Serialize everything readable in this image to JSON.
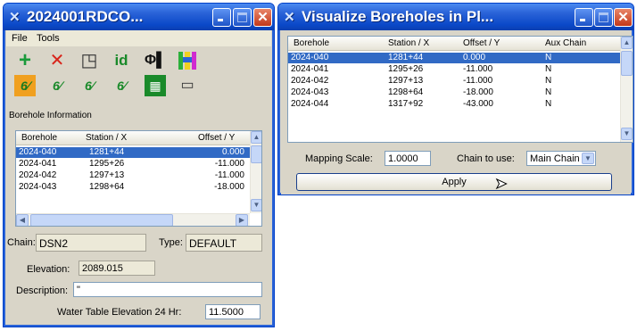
{
  "win1": {
    "title": "2024001RDCO...",
    "menu": [
      "File",
      "Tools"
    ],
    "tools_row1": [
      {
        "icon": "add-point-icon",
        "glyph": "+"
      },
      {
        "icon": "delete-icon",
        "glyph": "✕"
      },
      {
        "icon": "window-icon",
        "glyph": "◳"
      },
      {
        "icon": "id-icon",
        "glyph": "id"
      },
      {
        "icon": "diameter-icon",
        "glyph": "Φ▌"
      },
      {
        "icon": "color-bars-icon",
        "glyph": "▐▌"
      }
    ],
    "tools_row2": [
      {
        "icon": "borehole-symbol-icon",
        "glyph": "6∕"
      },
      {
        "icon": "borehole-tool-icon",
        "glyph": "6∕"
      },
      {
        "icon": "borehole-edit-icon",
        "glyph": "6∕"
      },
      {
        "icon": "borehole-elevation-icon",
        "glyph": "6∕"
      },
      {
        "icon": "import-csv-icon",
        "glyph": "▦"
      },
      {
        "icon": "text-note-icon",
        "glyph": "▭"
      }
    ],
    "section_label": "Borehole Information",
    "columns": [
      "Borehole",
      "Station / X",
      "Offset / Y"
    ],
    "rows": [
      {
        "borehole": "2024-040",
        "station": "1281+44",
        "offset": "0.000",
        "selected": true
      },
      {
        "borehole": "2024-041",
        "station": "1295+26",
        "offset": "-11.000",
        "selected": false
      },
      {
        "borehole": "2024-042",
        "station": "1297+13",
        "offset": "-11.000",
        "selected": false
      },
      {
        "borehole": "2024-043",
        "station": "1298+64",
        "offset": "-18.000",
        "selected": false
      }
    ],
    "chain_label": "Chain:",
    "chain_value": "DSN2",
    "type_label": "Type:",
    "type_value": "DEFAULT",
    "elevation_label": "Elevation:",
    "elevation_value": "2089.015",
    "description_label": "Description:",
    "description_value": "\"",
    "water_label": "Water Table Elevation 24 Hr:",
    "water_value": "11.5000"
  },
  "win2": {
    "title": "Visualize Boreholes in Pl...",
    "columns": [
      "Borehole",
      "Station / X",
      "Offset / Y",
      "Aux Chain"
    ],
    "rows": [
      {
        "borehole": "2024-040",
        "station": "1281+44",
        "offset": "0.000",
        "aux": "N",
        "selected": true
      },
      {
        "borehole": "2024-041",
        "station": "1295+26",
        "offset": "-11.000",
        "aux": "N",
        "selected": false
      },
      {
        "borehole": "2024-042",
        "station": "1297+13",
        "offset": "-11.000",
        "aux": "N",
        "selected": false
      },
      {
        "borehole": "2024-043",
        "station": "1298+64",
        "offset": "-18.000",
        "aux": "N",
        "selected": false
      },
      {
        "borehole": "2024-044",
        "station": "1317+92",
        "offset": "-43.000",
        "aux": "N",
        "selected": false
      }
    ],
    "mapping_label": "Mapping Scale:",
    "mapping_value": "1.0000",
    "chain_label": "Chain to use:",
    "chain_value": "Main Chain",
    "apply_label": "Apply"
  },
  "colors": {
    "title_blue": "#0a48c8",
    "selection": "#316ac5",
    "close_red": "#c3381a"
  }
}
